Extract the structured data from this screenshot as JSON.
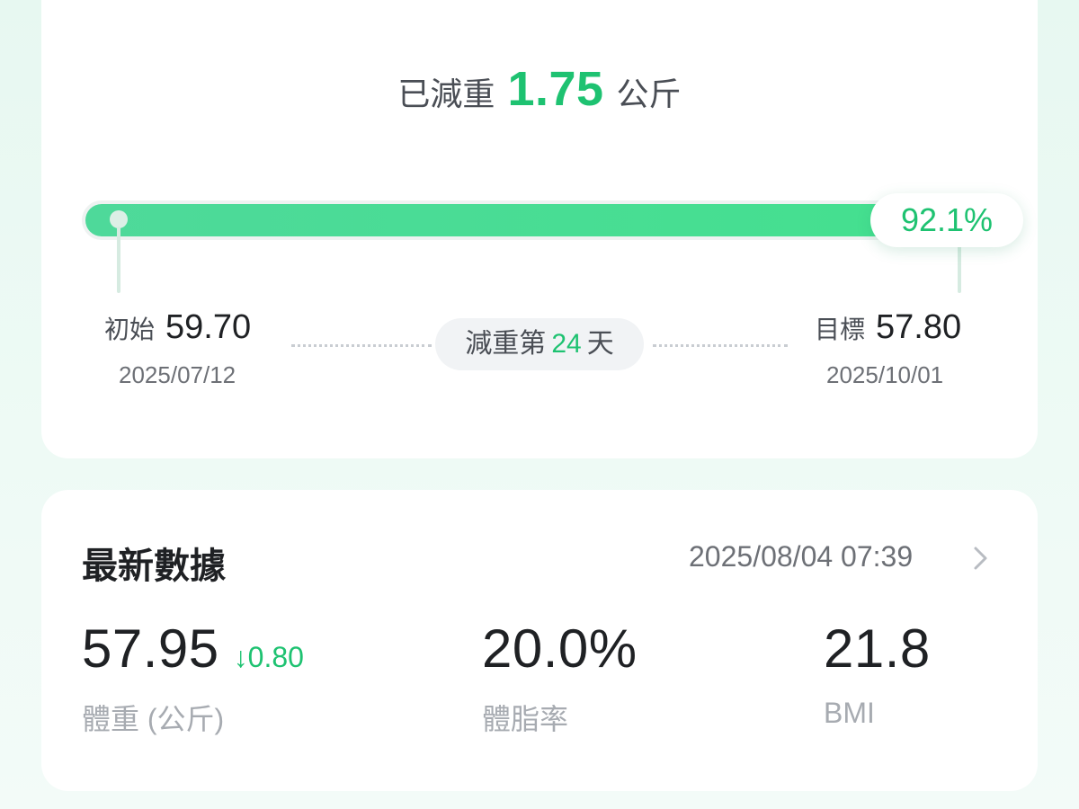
{
  "colors": {
    "accent": "#1ec271",
    "bar": "#44e08f",
    "text": "#1f2124",
    "muted": "#a7abb1"
  },
  "progress": {
    "headline_prefix": "已減重",
    "lost_value": "1.75",
    "unit": "公斤",
    "percent": 92.1,
    "percent_label": "92.1%",
    "start": {
      "label": "初始",
      "value": "59.70",
      "date": "2025/07/12"
    },
    "goal": {
      "label": "目標",
      "value": "57.80",
      "date": "2025/10/01"
    },
    "day": {
      "prefix": "減重第",
      "number": "24",
      "suffix": "天"
    }
  },
  "latest": {
    "title": "最新數據",
    "timestamp": "2025/08/04 07:39",
    "chevron_icon": "chevron-right-icon",
    "weight": {
      "value": "57.95",
      "delta": "↓0.80",
      "label": "體重 (公斤)"
    },
    "body_fat": {
      "value": "20.0%",
      "label": "體脂率"
    },
    "bmi": {
      "value": "21.8",
      "label": "BMI"
    }
  }
}
